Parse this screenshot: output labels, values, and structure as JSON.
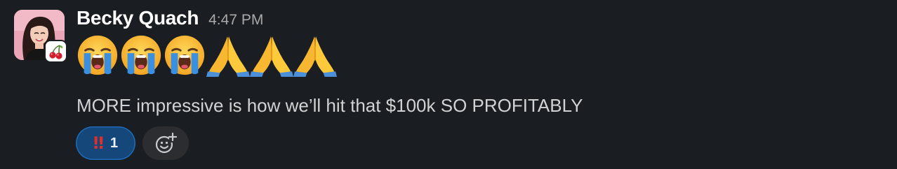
{
  "message": {
    "sender": "Becky Quach",
    "timestamp": "4:47 PM",
    "avatar_icon": "user-avatar-photo",
    "badge_icon": "cherries-icon",
    "emojis": [
      "loudly-crying-face-icon",
      "loudly-crying-face-icon",
      "loudly-crying-face-icon",
      "folded-hands-icon",
      "folded-hands-icon",
      "folded-hands-icon"
    ],
    "text": "MORE impressive is how we’ll hit that $100k SO PROFITABLY"
  },
  "reactions": [
    {
      "emoji": "‼",
      "icon": "double-exclamation-icon",
      "count": "1"
    }
  ],
  "add_reaction_icon": "add-reaction-icon",
  "colors": {
    "background": "#1a1d21",
    "reaction_bg": "#16477a",
    "reaction_border": "#1d6bb8",
    "add_reaction_bg": "#2c2d30"
  }
}
